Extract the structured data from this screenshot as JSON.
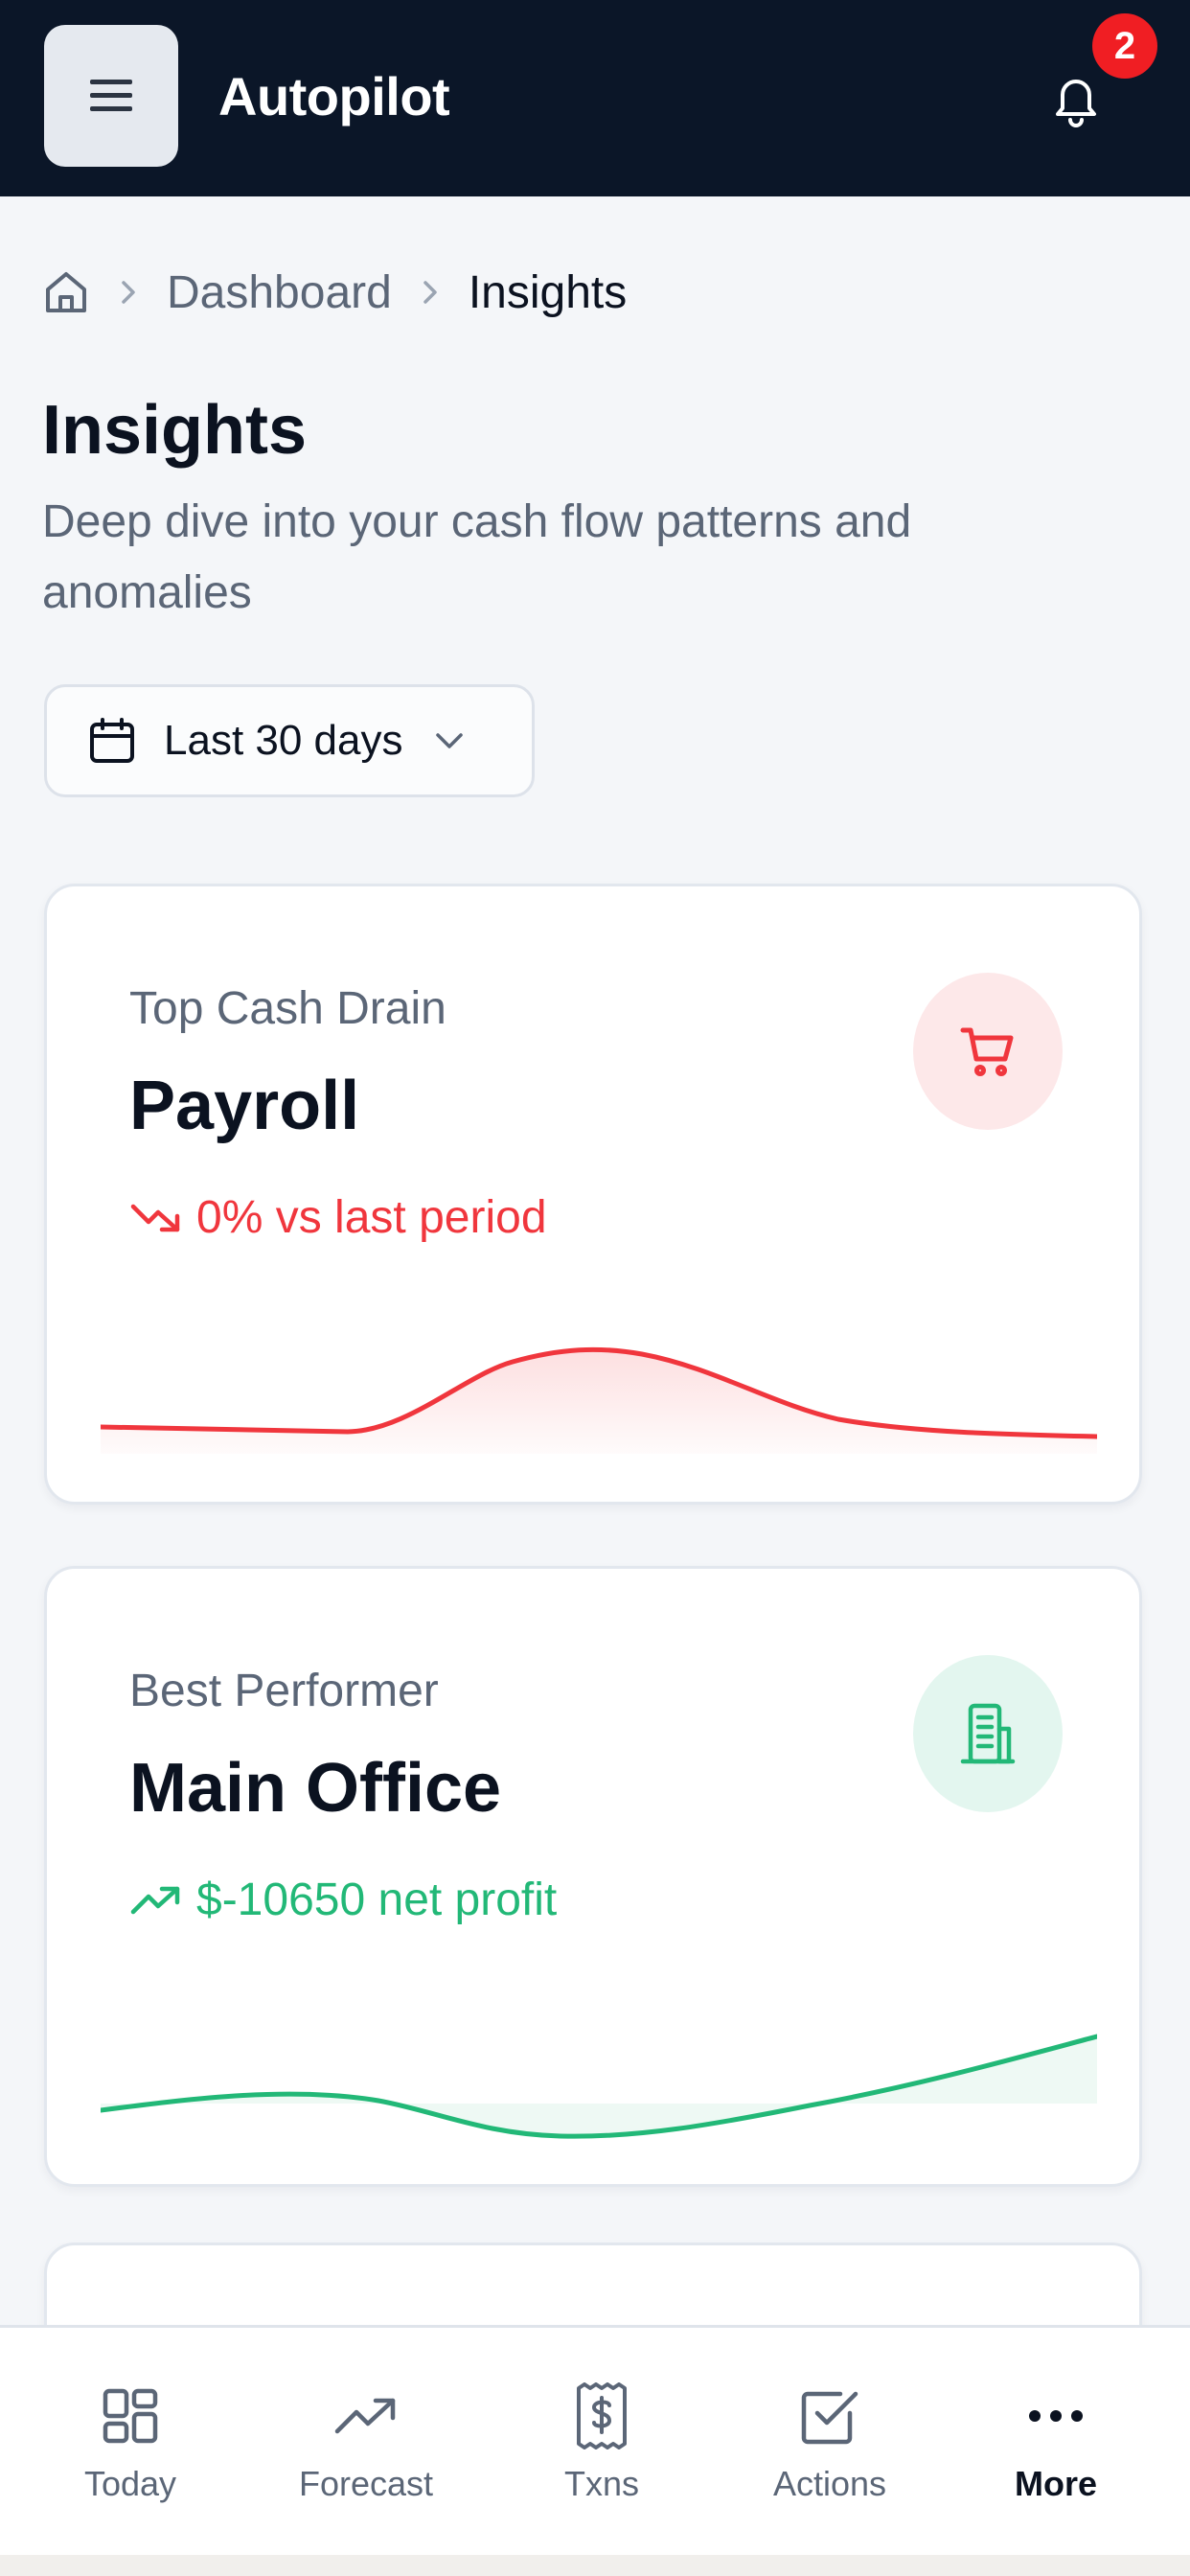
{
  "header": {
    "menu_icon": "hamburger-icon",
    "app_title": "Autopilot",
    "notification_icon": "bell-icon",
    "notification_count": "2"
  },
  "breadcrumb": {
    "home_icon": "home-icon",
    "items": [
      "Dashboard",
      "Insights"
    ]
  },
  "page": {
    "title": "Insights",
    "subtitle": "Deep dive into your cash flow patterns and anomalies"
  },
  "date_filter": {
    "icon": "calendar-icon",
    "selected": "Last 30 days"
  },
  "cards": [
    {
      "eyebrow": "Top Cash Drain",
      "headline": "Payroll",
      "metric": "0% vs last period",
      "trend": "down",
      "icon": "cart-icon",
      "color": "#f0363d",
      "tint": "#fde8e9"
    },
    {
      "eyebrow": "Best Performer",
      "headline": "Main Office",
      "metric": "$-10650 net profit",
      "trend": "up",
      "icon": "building-icon",
      "color": "#22b877",
      "tint": "#e3f6ef"
    }
  ],
  "bottom_nav": {
    "items": [
      {
        "label": "Today",
        "icon": "grid-icon"
      },
      {
        "label": "Forecast",
        "icon": "trending-up-icon"
      },
      {
        "label": "Txns",
        "icon": "receipt-dollar-icon"
      },
      {
        "label": "Actions",
        "icon": "checkbox-icon"
      },
      {
        "label": "More",
        "icon": "more-dots-icon",
        "active": true
      }
    ]
  }
}
